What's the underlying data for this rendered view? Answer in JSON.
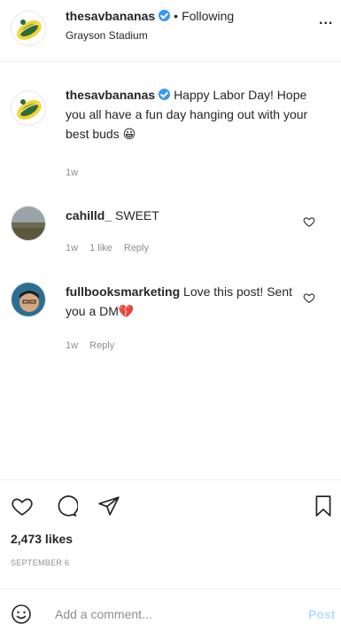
{
  "header": {
    "username": "thesavbananas",
    "separator": "•",
    "follow_status": "Following",
    "location": "Grayson Stadium",
    "more_glyph": "..."
  },
  "caption": {
    "username": "thesavbananas",
    "text": "Happy Labor Day! Hope you all have a fun day hanging out with your best buds",
    "emoji": "😀",
    "time": "1w"
  },
  "comments": [
    {
      "username": "cahilld_",
      "text": "SWEET",
      "time": "1w",
      "likes": "1 like",
      "reply": "Reply"
    },
    {
      "username": "fullbooksmarketing",
      "text": "Love this post! Sent you a DM",
      "emoji": "💔",
      "time": "1w",
      "reply": "Reply"
    }
  ],
  "post": {
    "likes": "2,473 likes",
    "date": "SEPTEMBER 6"
  },
  "comment_box": {
    "placeholder": "Add a comment...",
    "post_label": "Post"
  },
  "colors": {
    "verified": "#3897f0",
    "muted": "#8e8e8e",
    "post_disabled": "#b2dffc",
    "heart_emoji": "#e0245e"
  },
  "icons": {
    "header_avatar": "bananas-logo-icon",
    "caption_avatar": "bananas-logo-icon",
    "comment1_avatar": "landscape-avatar",
    "comment2_avatar": "person-avatar",
    "like": "heart-icon",
    "comment": "speech-bubble-icon",
    "share": "paper-plane-icon",
    "save": "bookmark-icon",
    "emoji": "smiley-icon"
  }
}
